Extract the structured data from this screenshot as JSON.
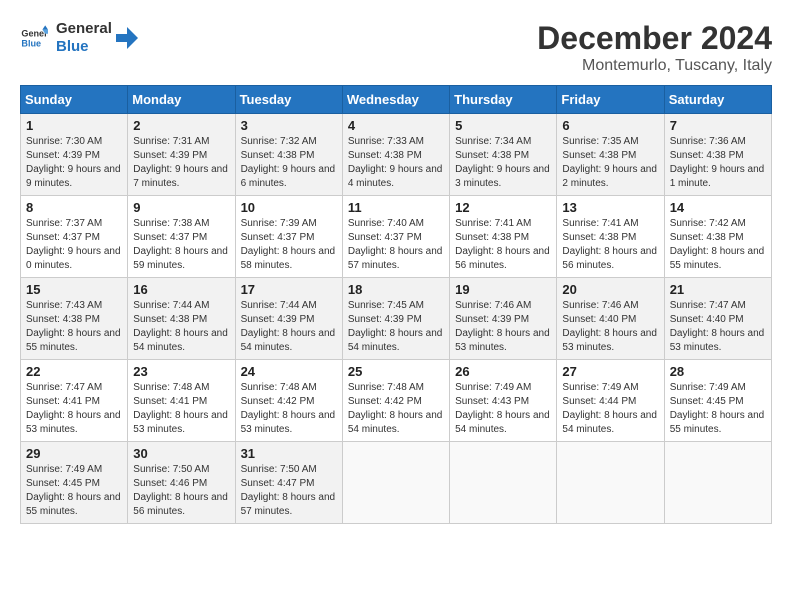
{
  "header": {
    "logo_line1": "General",
    "logo_line2": "Blue",
    "title": "December 2024",
    "subtitle": "Montemurlo, Tuscany, Italy"
  },
  "days_of_week": [
    "Sunday",
    "Monday",
    "Tuesday",
    "Wednesday",
    "Thursday",
    "Friday",
    "Saturday"
  ],
  "weeks": [
    [
      {
        "day": "1",
        "sunrise": "7:30 AM",
        "sunset": "4:39 PM",
        "daylight": "9 hours and 9 minutes."
      },
      {
        "day": "2",
        "sunrise": "7:31 AM",
        "sunset": "4:39 PM",
        "daylight": "9 hours and 7 minutes."
      },
      {
        "day": "3",
        "sunrise": "7:32 AM",
        "sunset": "4:38 PM",
        "daylight": "9 hours and 6 minutes."
      },
      {
        "day": "4",
        "sunrise": "7:33 AM",
        "sunset": "4:38 PM",
        "daylight": "9 hours and 4 minutes."
      },
      {
        "day": "5",
        "sunrise": "7:34 AM",
        "sunset": "4:38 PM",
        "daylight": "9 hours and 3 minutes."
      },
      {
        "day": "6",
        "sunrise": "7:35 AM",
        "sunset": "4:38 PM",
        "daylight": "9 hours and 2 minutes."
      },
      {
        "day": "7",
        "sunrise": "7:36 AM",
        "sunset": "4:38 PM",
        "daylight": "9 hours and 1 minute."
      }
    ],
    [
      {
        "day": "8",
        "sunrise": "7:37 AM",
        "sunset": "4:37 PM",
        "daylight": "9 hours and 0 minutes."
      },
      {
        "day": "9",
        "sunrise": "7:38 AM",
        "sunset": "4:37 PM",
        "daylight": "8 hours and 59 minutes."
      },
      {
        "day": "10",
        "sunrise": "7:39 AM",
        "sunset": "4:37 PM",
        "daylight": "8 hours and 58 minutes."
      },
      {
        "day": "11",
        "sunrise": "7:40 AM",
        "sunset": "4:37 PM",
        "daylight": "8 hours and 57 minutes."
      },
      {
        "day": "12",
        "sunrise": "7:41 AM",
        "sunset": "4:38 PM",
        "daylight": "8 hours and 56 minutes."
      },
      {
        "day": "13",
        "sunrise": "7:41 AM",
        "sunset": "4:38 PM",
        "daylight": "8 hours and 56 minutes."
      },
      {
        "day": "14",
        "sunrise": "7:42 AM",
        "sunset": "4:38 PM",
        "daylight": "8 hours and 55 minutes."
      }
    ],
    [
      {
        "day": "15",
        "sunrise": "7:43 AM",
        "sunset": "4:38 PM",
        "daylight": "8 hours and 55 minutes."
      },
      {
        "day": "16",
        "sunrise": "7:44 AM",
        "sunset": "4:38 PM",
        "daylight": "8 hours and 54 minutes."
      },
      {
        "day": "17",
        "sunrise": "7:44 AM",
        "sunset": "4:39 PM",
        "daylight": "8 hours and 54 minutes."
      },
      {
        "day": "18",
        "sunrise": "7:45 AM",
        "sunset": "4:39 PM",
        "daylight": "8 hours and 54 minutes."
      },
      {
        "day": "19",
        "sunrise": "7:46 AM",
        "sunset": "4:39 PM",
        "daylight": "8 hours and 53 minutes."
      },
      {
        "day": "20",
        "sunrise": "7:46 AM",
        "sunset": "4:40 PM",
        "daylight": "8 hours and 53 minutes."
      },
      {
        "day": "21",
        "sunrise": "7:47 AM",
        "sunset": "4:40 PM",
        "daylight": "8 hours and 53 minutes."
      }
    ],
    [
      {
        "day": "22",
        "sunrise": "7:47 AM",
        "sunset": "4:41 PM",
        "daylight": "8 hours and 53 minutes."
      },
      {
        "day": "23",
        "sunrise": "7:48 AM",
        "sunset": "4:41 PM",
        "daylight": "8 hours and 53 minutes."
      },
      {
        "day": "24",
        "sunrise": "7:48 AM",
        "sunset": "4:42 PM",
        "daylight": "8 hours and 53 minutes."
      },
      {
        "day": "25",
        "sunrise": "7:48 AM",
        "sunset": "4:42 PM",
        "daylight": "8 hours and 54 minutes."
      },
      {
        "day": "26",
        "sunrise": "7:49 AM",
        "sunset": "4:43 PM",
        "daylight": "8 hours and 54 minutes."
      },
      {
        "day": "27",
        "sunrise": "7:49 AM",
        "sunset": "4:44 PM",
        "daylight": "8 hours and 54 minutes."
      },
      {
        "day": "28",
        "sunrise": "7:49 AM",
        "sunset": "4:45 PM",
        "daylight": "8 hours and 55 minutes."
      }
    ],
    [
      {
        "day": "29",
        "sunrise": "7:49 AM",
        "sunset": "4:45 PM",
        "daylight": "8 hours and 55 minutes."
      },
      {
        "day": "30",
        "sunrise": "7:50 AM",
        "sunset": "4:46 PM",
        "daylight": "8 hours and 56 minutes."
      },
      {
        "day": "31",
        "sunrise": "7:50 AM",
        "sunset": "4:47 PM",
        "daylight": "8 hours and 57 minutes."
      },
      null,
      null,
      null,
      null
    ]
  ],
  "labels": {
    "sunrise": "Sunrise:",
    "sunset": "Sunset:",
    "daylight": "Daylight:"
  }
}
